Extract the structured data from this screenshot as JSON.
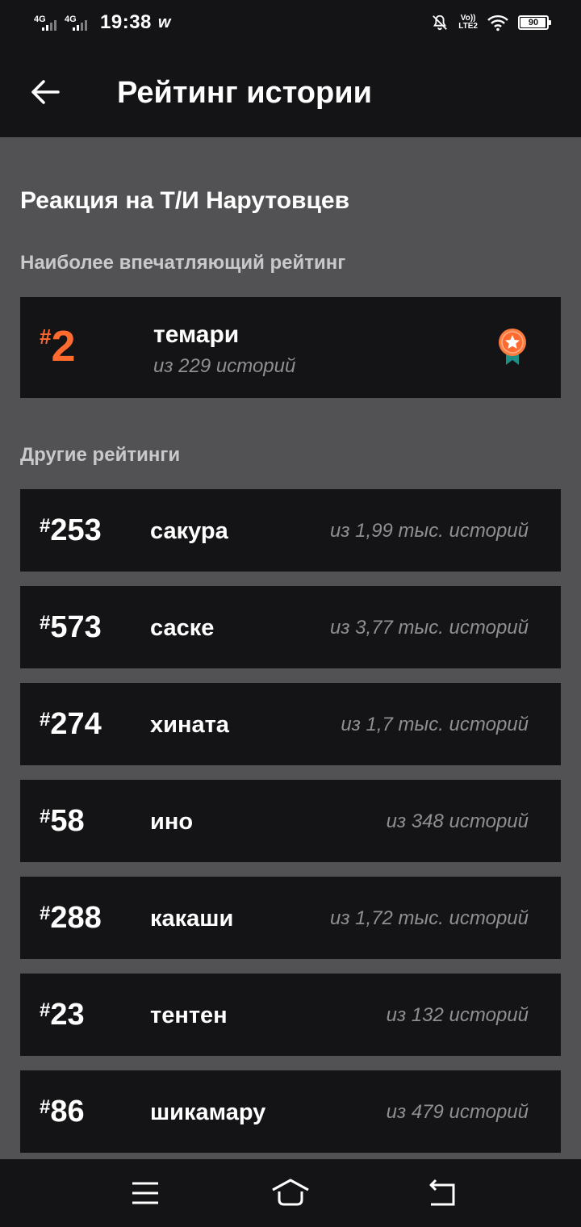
{
  "status_bar": {
    "network_1": "4G",
    "network_2": "4G",
    "time": "19:38",
    "volte_top": "Vo))",
    "volte_bottom": "LTE2",
    "battery": "90",
    "battery_level": 0.9,
    "icons": [
      "signal-icon",
      "signal-icon",
      "w-notification-icon",
      "mute-bell-icon",
      "wifi-icon",
      "battery-icon"
    ]
  },
  "header": {
    "title": "Рейтинг истории",
    "back_icon": "arrow-left-icon"
  },
  "story": {
    "title": "Реакция на Т/И Нарутовцев"
  },
  "top_ranking": {
    "section_label": "Наиболее впечатляющий рейтинг",
    "hash": "#",
    "rank": "2",
    "tag": "темари",
    "count": "из 229 историй",
    "icon": "medal-icon",
    "accent": "#ff6a2f"
  },
  "other_rankings": {
    "section_label": "Другие рейтинги",
    "items": [
      {
        "hash": "#",
        "rank": "253",
        "tag": "сакура",
        "count": "из 1,99 тыс. историй"
      },
      {
        "hash": "#",
        "rank": "573",
        "tag": "саске",
        "count": "из 3,77 тыс. историй"
      },
      {
        "hash": "#",
        "rank": "274",
        "tag": "хината",
        "count": "из 1,7 тыс. историй"
      },
      {
        "hash": "#",
        "rank": "58",
        "tag": "ино",
        "count": "из 348 историй"
      },
      {
        "hash": "#",
        "rank": "288",
        "tag": "какаши",
        "count": "из 1,72 тыс. историй"
      },
      {
        "hash": "#",
        "rank": "23",
        "tag": "тентен",
        "count": "из 132 историй"
      },
      {
        "hash": "#",
        "rank": "86",
        "tag": "шикамару",
        "count": "из 479 историй"
      }
    ]
  },
  "nav_bar": {
    "icons": [
      "menu-icon",
      "home-icon",
      "back-icon"
    ]
  }
}
